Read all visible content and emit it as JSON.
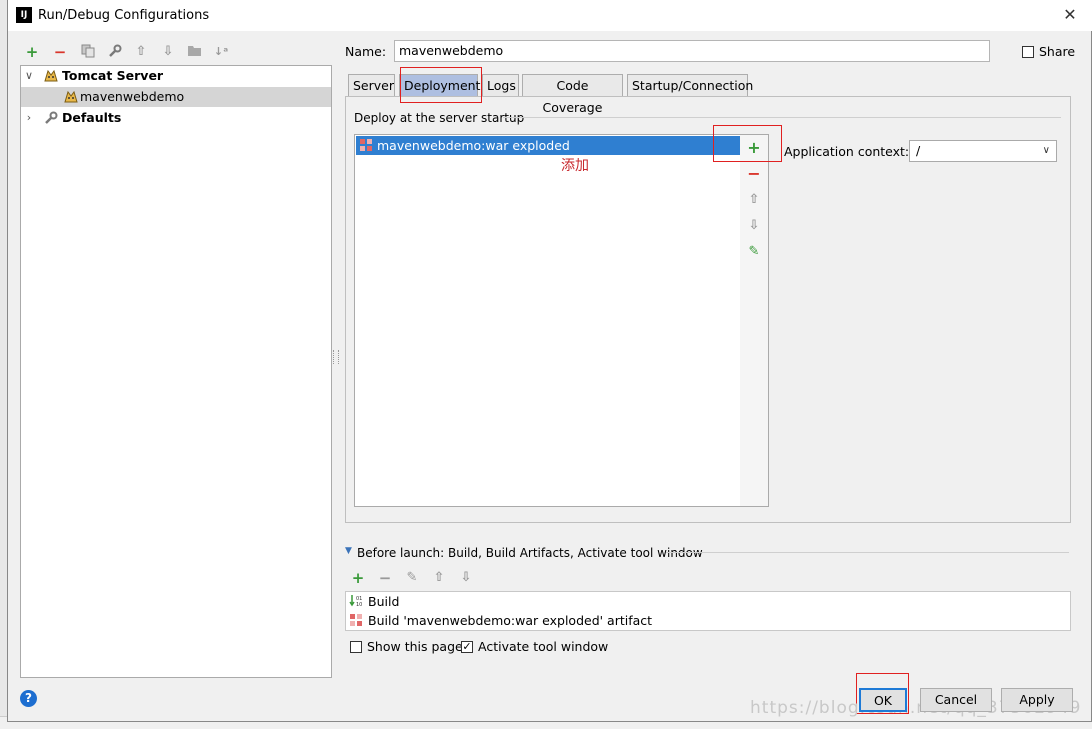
{
  "window": {
    "title": "Run/Debug Configurations",
    "logo_text": "IJ",
    "close_glyph": "✕"
  },
  "toolbar": {
    "icons": [
      "add-icon",
      "remove-icon",
      "copy-icon",
      "wrench-icon",
      "arrow-up-icon",
      "arrow-down-icon",
      "folder-icon",
      "sort-icon"
    ]
  },
  "tree": {
    "items": [
      {
        "label": "Tomcat Server",
        "bold": true,
        "expanded": true
      },
      {
        "label": "mavenwebdemo",
        "bold": false,
        "selected": true
      },
      {
        "label": "Defaults",
        "bold": true,
        "expanded": false
      }
    ]
  },
  "name_field": {
    "label": "Name:",
    "value": "mavenwebdemo"
  },
  "share": {
    "label": "Share",
    "checked": false
  },
  "tabs": [
    {
      "label": "Server",
      "active": false
    },
    {
      "label": "Deployment",
      "active": true
    },
    {
      "label": "Logs",
      "active": false
    },
    {
      "label": "Code Coverage",
      "active": false
    },
    {
      "label": "Startup/Connection",
      "active": false
    }
  ],
  "deployment": {
    "section_title": "Deploy at the server startup",
    "items": [
      "mavenwebdemo:war exploded"
    ],
    "annotation": "添加",
    "side_toolbar": [
      "add-icon",
      "remove-icon",
      "arrow-up-icon",
      "arrow-down-icon",
      "edit-icon"
    ],
    "app_context_label": "Application context:",
    "app_context_value": "/"
  },
  "before_launch": {
    "title": "Before launch: Build, Build Artifacts, Activate tool window",
    "toolbar": [
      "add-icon",
      "remove-icon",
      "edit-icon",
      "arrow-up-icon",
      "arrow-down-icon"
    ],
    "items": [
      {
        "label": "Build",
        "icon": "build-icon"
      },
      {
        "label": "Build 'mavenwebdemo:war exploded' artifact",
        "icon": "artifact-icon"
      }
    ]
  },
  "options": {
    "show_page": {
      "label": "Show this page",
      "checked": false
    },
    "activate_window": {
      "label": "Activate tool window",
      "checked": true
    }
  },
  "buttons": {
    "ok": "OK",
    "cancel": "Cancel",
    "apply": "Apply",
    "help": "?"
  },
  "watermark": "https://blog.csdn.net/qq_37502949",
  "colors": {
    "selection": "#2f7fd1",
    "active_tab": "#aebfe1",
    "annotation_red": "#e02020",
    "add_green": "#3a9a3a",
    "remove_red": "#d9352b"
  }
}
